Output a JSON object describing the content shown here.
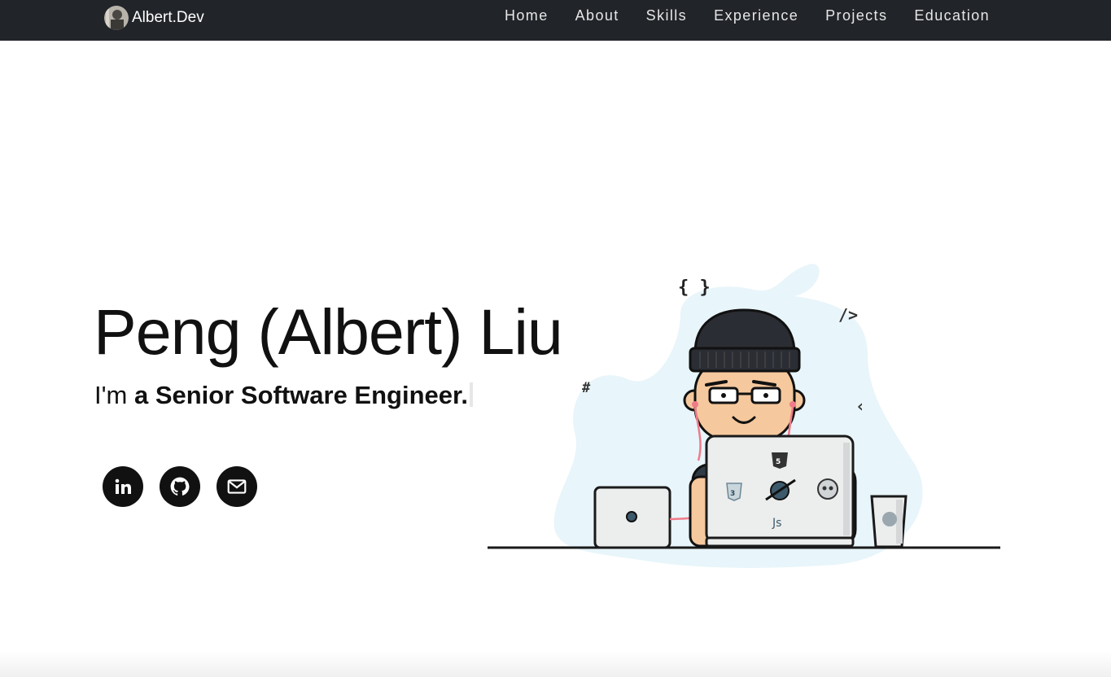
{
  "navbar": {
    "brand": "Albert.Dev",
    "links": [
      {
        "label": "Home"
      },
      {
        "label": "About"
      },
      {
        "label": "Skills"
      },
      {
        "label": "Experience"
      },
      {
        "label": "Projects"
      },
      {
        "label": "Education"
      }
    ],
    "background": "#212429"
  },
  "hero": {
    "name": "Peng (Albert) Liu",
    "subtitle_prefix": "I'm ",
    "subtitle_strong": "a Senior Software Engineer.",
    "socials": [
      {
        "icon": "linkedin-icon"
      },
      {
        "icon": "github-icon"
      },
      {
        "icon": "email-icon"
      }
    ]
  },
  "illustration": {
    "symbols": [
      "{ }",
      "/>",
      "#",
      "‹"
    ],
    "laptop_label": "Js",
    "blob_color": "#e8f5fa"
  }
}
